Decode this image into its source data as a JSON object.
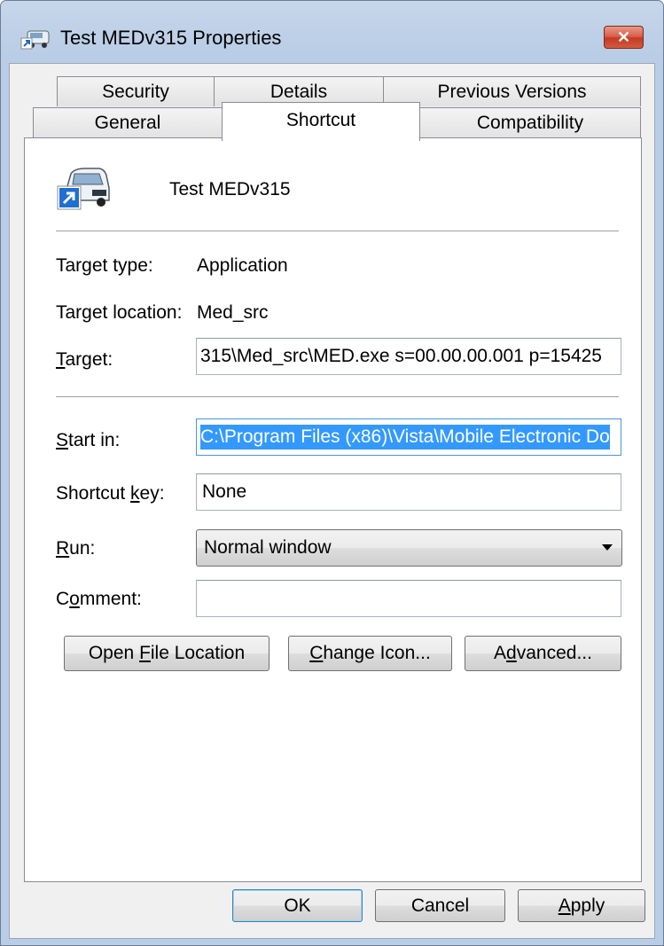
{
  "window": {
    "title": "Test MEDv315 Properties",
    "close_label": "✕"
  },
  "tabs": {
    "row1": [
      "Security",
      "Details",
      "Previous Versions"
    ],
    "row2": [
      "General",
      "Shortcut",
      "Compatibility"
    ],
    "active": "Shortcut"
  },
  "shortcut": {
    "name": "Test MEDv315",
    "target_type_label": "Target type:",
    "target_type_value": "Application",
    "target_location_label": "Target location:",
    "target_location_value": "Med_src",
    "target_label": "Target:",
    "target_value": "315\\Med_src\\MED.exe s=00.00.00.001 p=15425",
    "start_in_label": "Start in:",
    "start_in_value": "C:\\Program Files (x86)\\Vista\\Mobile Electronic Do",
    "shortcut_key_label": "Shortcut key:",
    "shortcut_key_value": "None",
    "run_label": "Run:",
    "run_value": "Normal window",
    "comment_label": "Comment:",
    "comment_value": ""
  },
  "buttons": {
    "open_file_location": "Open File Location",
    "change_icon": "Change Icon...",
    "advanced": "Advanced...",
    "ok": "OK",
    "cancel": "Cancel",
    "apply": "Apply"
  },
  "colors": {
    "selection": "#3399ff",
    "close_button": "#c23a25"
  },
  "icons": [
    "shortcut-app-icon",
    "close-icon",
    "shortcut-arrow-icon",
    "dropdown-arrow-icon"
  ]
}
